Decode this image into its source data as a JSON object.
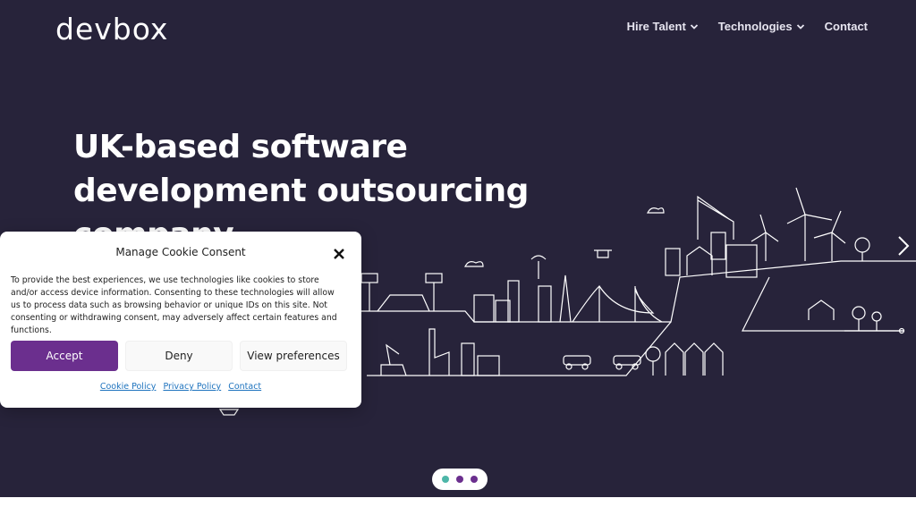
{
  "header": {
    "logo_text": "devbox",
    "nav": [
      {
        "label": "Hire Talent",
        "has_dropdown": true
      },
      {
        "label": "Technologies",
        "has_dropdown": true
      },
      {
        "label": "Contact",
        "has_dropdown": false
      }
    ]
  },
  "hero": {
    "headline": "UK-based software development outsourcing company",
    "slider_dots": [
      {
        "color": "#4db6a8",
        "active": true
      },
      {
        "color": "#6b2f8e",
        "active": false
      },
      {
        "color": "#6b2f8e",
        "active": false
      }
    ]
  },
  "cookie_banner": {
    "title": "Manage Cookie Consent",
    "body": "To provide the best experiences, we use technologies like cookies to store and/or access device information. Consenting to these technologies will allow us to process data such as browsing behavior or unique IDs on this site. Not consenting or withdrawing consent, may adversely affect certain features and functions.",
    "accept_label": "Accept",
    "deny_label": "Deny",
    "preferences_label": "View preferences",
    "links": [
      "Cookie Policy",
      "Privacy Policy",
      "Contact"
    ]
  },
  "colors": {
    "hero_bg": "#27233a",
    "accent_purple": "#6b2f8e",
    "accent_teal": "#4db6a8",
    "link_blue": "#1e73be"
  },
  "icons": {
    "nav_dropdown": "chevron-down-icon",
    "slider_next": "chevron-right-icon",
    "cookie_close": "close-icon"
  }
}
